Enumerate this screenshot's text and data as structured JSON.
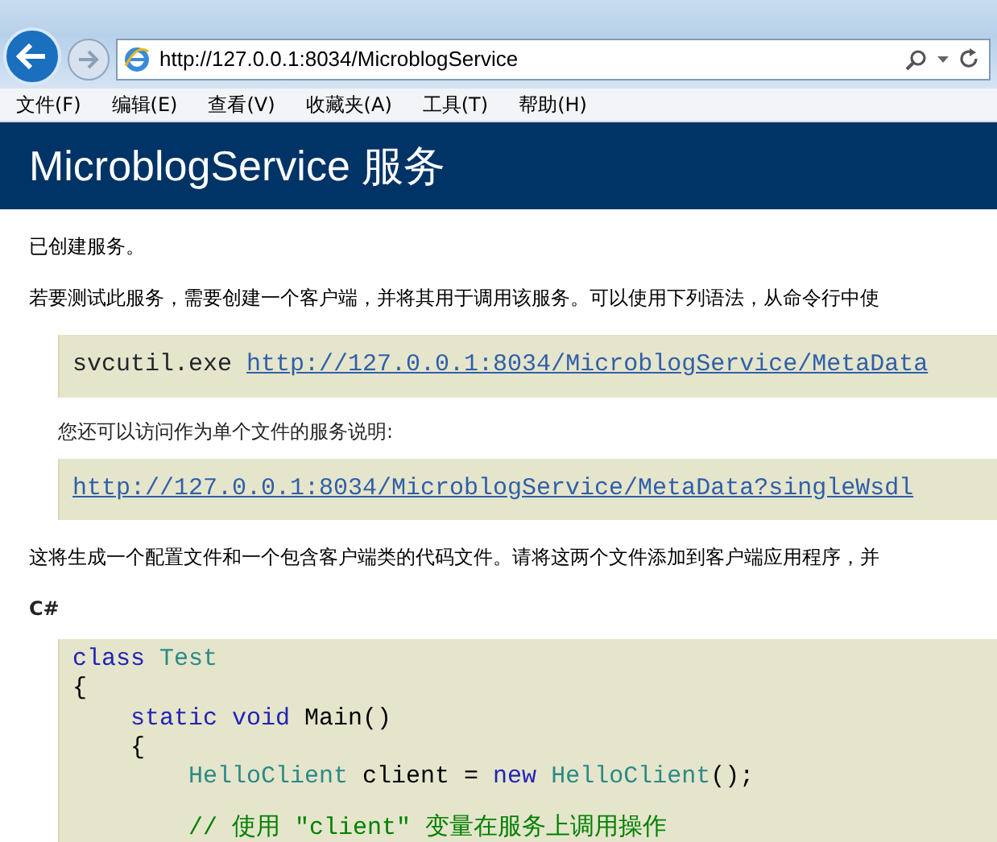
{
  "address_bar": {
    "url": "http://127.0.0.1:8034/MicroblogService"
  },
  "menu": [
    {
      "label": "文件(F)"
    },
    {
      "label": "编辑(E)"
    },
    {
      "label": "查看(V)"
    },
    {
      "label": "收藏夹(A)"
    },
    {
      "label": "工具(T)"
    },
    {
      "label": "帮助(H)"
    }
  ],
  "header": {
    "title": "MicroblogService 服务"
  },
  "content": [
    {
      "kind": "para",
      "text": "已创建服务。"
    },
    {
      "kind": "para",
      "text": "若要测试此服务，需要创建一个客户端，并将其用于调用该服务。可以使用下列语法，从命令行中使"
    },
    {
      "kind": "command",
      "prefix": "svcutil.exe ",
      "link": "http://127.0.0.1:8034/MicroblogService/MetaData"
    },
    {
      "kind": "note",
      "text": "您还可以访问作为单个文件的服务说明:"
    },
    {
      "kind": "linkblock",
      "link": "http://127.0.0.1:8034/MicroblogService/MetaData?singleWsdl"
    },
    {
      "kind": "para",
      "text": "这将生成一个配置文件和一个包含客户端类的代码文件。请将这两个文件添加到客户端应用程序，并"
    },
    {
      "kind": "heading",
      "text": "C#"
    },
    {
      "kind": "code",
      "lines": [
        {
          "tokens": [
            {
              "kind": "keyword",
              "text": "class "
            },
            {
              "kind": "type",
              "text": "Test"
            }
          ]
        },
        {
          "tokens": [
            {
              "kind": "plain",
              "text": "{"
            }
          ]
        },
        {
          "tokens": [
            {
              "kind": "keyword",
              "text": "    static void"
            },
            {
              "kind": "plain",
              "text": " Main()"
            }
          ]
        },
        {
          "tokens": [
            {
              "kind": "plain",
              "text": "    {"
            }
          ]
        },
        {
          "tokens": [
            {
              "kind": "type",
              "text": "        HelloClient"
            },
            {
              "kind": "plain",
              "text": " client = "
            },
            {
              "kind": "keyword",
              "text": "new "
            },
            {
              "kind": "type",
              "text": "HelloClient"
            },
            {
              "kind": "plain",
              "text": "();"
            }
          ]
        },
        {
          "space_before": true,
          "tokens": [
            {
              "kind": "comment",
              "text": "        // 使用 \"client\" 变量在服务上调用操作"
            }
          ]
        }
      ]
    }
  ]
}
